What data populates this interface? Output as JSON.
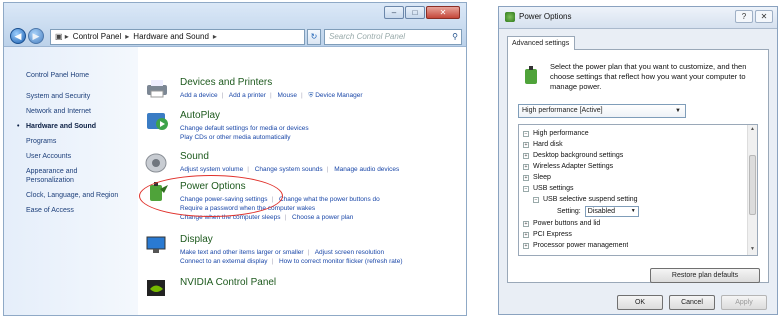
{
  "control_panel": {
    "breadcrumb": [
      "Control Panel",
      "Hardware and Sound"
    ],
    "search_placeholder": "Search Control Panel",
    "sidebar": [
      "Control Panel Home",
      "System and Security",
      "Network and Internet",
      "Hardware and Sound",
      "Programs",
      "User Accounts",
      "Appearance and Personalization",
      "Clock, Language, and Region",
      "Ease of Access"
    ],
    "sections": [
      {
        "title": "Devices and Printers",
        "links": [
          "Add a device",
          "Add a printer",
          "Mouse",
          "Device Manager"
        ]
      },
      {
        "title": "AutoPlay",
        "links": [
          "Change default settings for media or devices",
          "Play CDs or other media automatically"
        ]
      },
      {
        "title": "Sound",
        "links": [
          "Adjust system volume",
          "Change system sounds",
          "Manage audio devices"
        ]
      },
      {
        "title": "Power Options",
        "links": [
          "Change power-saving settings",
          "Change what the power buttons do",
          "Require a password when the computer wakes",
          "Change when the computer sleeps",
          "Choose a power plan"
        ]
      },
      {
        "title": "Display",
        "links": [
          "Make text and other items larger or smaller",
          "Adjust screen resolution",
          "Connect to an external display",
          "How to correct monitor flicker (refresh rate)"
        ]
      },
      {
        "title": "NVIDIA Control Panel",
        "links": []
      }
    ]
  },
  "dialog": {
    "title": "Power Options",
    "help": "?",
    "close": "✕",
    "tab": "Advanced settings",
    "description": "Select the power plan that you want to customize, and then choose settings that reflect how you want your computer to manage power.",
    "plan": "High performance [Active]",
    "tree": [
      {
        "label": "High performance",
        "sign": "−"
      },
      {
        "label": "Hard disk",
        "sign": "+"
      },
      {
        "label": "Desktop background settings",
        "sign": "+"
      },
      {
        "label": "Wireless Adapter Settings",
        "sign": "+"
      },
      {
        "label": "Sleep",
        "sign": "+"
      },
      {
        "label": "USB settings",
        "sign": "−"
      },
      {
        "label": "USB selective suspend setting",
        "sign": "−"
      },
      {
        "label": "Setting:",
        "value": "Disabled"
      },
      {
        "label": "Power buttons and lid",
        "sign": "+"
      },
      {
        "label": "PCI Express",
        "sign": "+"
      },
      {
        "label": "Processor power management",
        "sign": "+"
      }
    ],
    "restore_label": "Restore plan defaults",
    "ok_label": "OK",
    "cancel_label": "Cancel",
    "apply_label": "Apply"
  }
}
